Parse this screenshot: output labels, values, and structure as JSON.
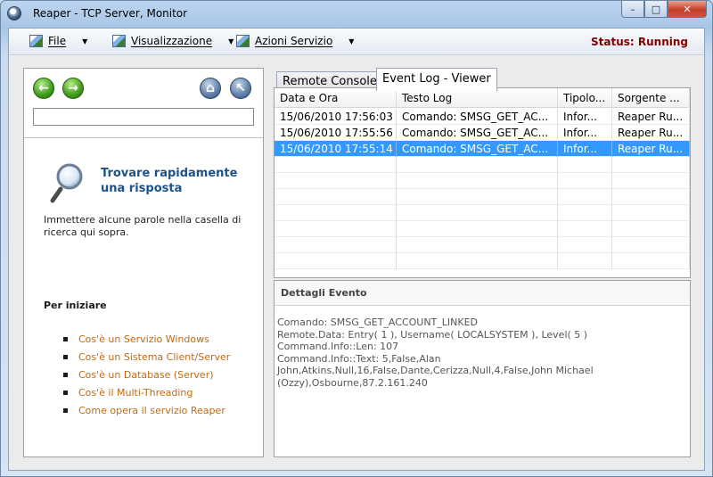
{
  "window": {
    "title": "Reaper - TCP Server,  Monitor",
    "controls": {
      "minimize": "–",
      "maximize": "□",
      "close": "✕"
    }
  },
  "menubar": {
    "items": [
      {
        "label": "File",
        "icon": "picture-icon"
      },
      {
        "label": "Visualizzazione",
        "icon": "picture-icon"
      },
      {
        "label": "Azioni Servizio",
        "icon": "picture-icon"
      }
    ],
    "dropdown_glyph": "▼",
    "status": "Status: Running"
  },
  "left_panel": {
    "nav": {
      "back": "←",
      "forward": "→",
      "home": "⌂",
      "up": "↖"
    },
    "search_value": "",
    "help": {
      "title": "Trovare rapidamente una risposta",
      "description": "Immettere alcune parole nella casella di ricerca qui sopra.",
      "start_heading": "Per iniziare",
      "links": [
        "Cos'è un Servizio Windows",
        "Cos'è un Sistema Client/Server",
        "Cos'è un Database (Server)",
        "Cos'è il Multi-Threading",
        "Come opera il servizio Reaper"
      ]
    }
  },
  "tabs": [
    {
      "label": "Remote Console",
      "active": false
    },
    {
      "label": "Event Log - Viewer",
      "active": true
    }
  ],
  "log_table": {
    "columns": [
      "Data e Ora",
      "Testo Log",
      "Tipolo...",
      "Sorgente ..."
    ],
    "rows": [
      {
        "date": "15/06/2010 17:56:03",
        "text": "Comando: SMSG_GET_AC...",
        "type": "Infor...",
        "source": "Reaper Ru...",
        "selected": false
      },
      {
        "date": "15/06/2010 17:55:56",
        "text": "Comando: SMSG_GET_AC...",
        "type": "Infor...",
        "source": "Reaper Ru...",
        "selected": false
      },
      {
        "date": "15/06/2010 17:55:14",
        "text": "Comando: SMSG_GET_AC...",
        "type": "Infor...",
        "source": "Reaper Ru...",
        "selected": true
      }
    ]
  },
  "details": {
    "title": "Dettagli Evento",
    "lines": [
      "Comando: SMSG_GET_ACCOUNT_LINKED",
      "Remote.Data: Entry( 1 ), Username( LOCALSYSTEM ), Level( 5 )",
      "Command.Info::Len: 107",
      "Command.Info::Text: 5,False,Alan",
      "John,Atkins,Null,16,False,Dante,Cerizza,Null,4,False,John Michael",
      "(Ozzy),Osbourne,87.2.161.240"
    ]
  }
}
